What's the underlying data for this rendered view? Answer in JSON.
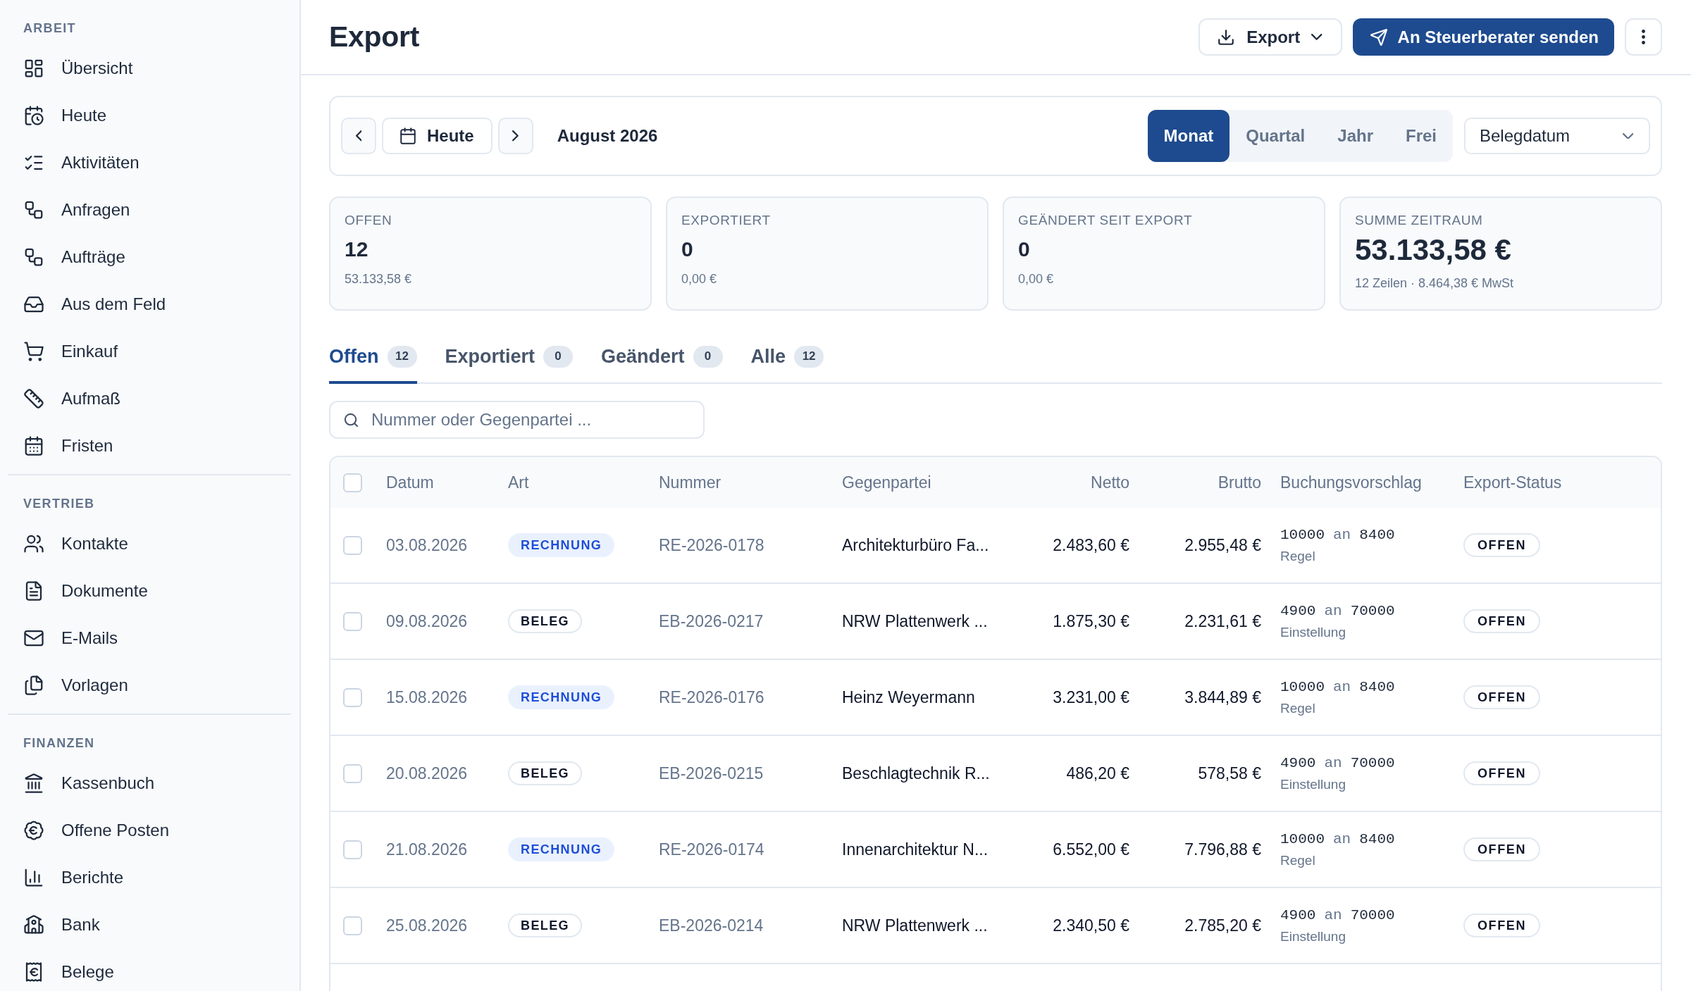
{
  "sidebar": {
    "sections": [
      {
        "title": "ARBEIT",
        "items": [
          {
            "label": "Übersicht",
            "selected": false
          },
          {
            "label": "Heute",
            "selected": false
          },
          {
            "label": "Aktivitäten",
            "selected": false
          },
          {
            "label": "Anfragen",
            "selected": false
          },
          {
            "label": "Aufträge",
            "selected": false
          },
          {
            "label": "Aus dem Feld",
            "selected": false
          },
          {
            "label": "Einkauf",
            "selected": false
          },
          {
            "label": "Aufmaß",
            "selected": false
          },
          {
            "label": "Fristen",
            "selected": false
          }
        ]
      },
      {
        "title": "VERTRIEB",
        "items": [
          {
            "label": "Kontakte",
            "selected": false
          },
          {
            "label": "Dokumente",
            "selected": false
          },
          {
            "label": "E-Mails",
            "selected": false
          },
          {
            "label": "Vorlagen",
            "selected": false
          }
        ]
      },
      {
        "title": "FINANZEN",
        "items": [
          {
            "label": "Kassenbuch",
            "selected": false
          },
          {
            "label": "Offene Posten",
            "selected": false
          },
          {
            "label": "Berichte",
            "selected": false
          },
          {
            "label": "Bank",
            "selected": false
          },
          {
            "label": "Belege",
            "selected": false
          }
        ]
      }
    ]
  },
  "header": {
    "title": "Export",
    "export_button": "Export",
    "send_button": "An Steuerberater senden"
  },
  "period_bar": {
    "today_button": "Heute",
    "period_label": "August 2026",
    "ranges": [
      {
        "label": "Monat",
        "selected": true
      },
      {
        "label": "Quartal",
        "selected": false
      },
      {
        "label": "Jahr",
        "selected": false
      },
      {
        "label": "Frei",
        "selected": false
      }
    ],
    "date_field": {
      "value": "Belegdatum"
    }
  },
  "stats": [
    {
      "kind": "count",
      "label": "OFFEN",
      "value": "12",
      "detail": "53.133,58 €"
    },
    {
      "kind": "count",
      "label": "EXPORTIERT",
      "value": "0",
      "detail": "0,00 €"
    },
    {
      "kind": "count",
      "label": "GEÄNDERT SEIT EXPORT",
      "value": "0",
      "detail": "0,00 €"
    },
    {
      "kind": "total",
      "label": "SUMME ZEITRAUM",
      "value": "53.133,58 €",
      "detail": "12 Zeilen · 8.464,38 € MwSt"
    }
  ],
  "tabs": [
    {
      "label": "Offen",
      "count": "12",
      "selected": true
    },
    {
      "label": "Exportiert",
      "count": "0",
      "selected": false
    },
    {
      "label": "Geändert",
      "count": "0",
      "selected": false
    },
    {
      "label": "Alle",
      "count": "12",
      "selected": false
    }
  ],
  "search": {
    "placeholder": "Nummer oder Gegenpartei ..."
  },
  "table": {
    "select_all_checked": false,
    "columns": [
      "Datum",
      "Art",
      "Nummer",
      "Gegenpartei",
      "Netto",
      "Brutto",
      "Buchungsvorschlag",
      "Export-Status"
    ],
    "rows": [
      {
        "checked": false,
        "date": "03.08.2026",
        "type": {
          "kind": "invoice",
          "label": "RECHNUNG"
        },
        "number": "RE-2026-0178",
        "counterparty": "Architekturbüro Fa...",
        "net": "2.483,60 €",
        "gross": "2.955,48 €",
        "booking": {
          "debit": "10000",
          "connector": "an",
          "credit": "8400",
          "source": "Regel"
        },
        "status": "OFFEN"
      },
      {
        "checked": false,
        "date": "09.08.2026",
        "type": {
          "kind": "receipt",
          "label": "BELEG"
        },
        "number": "EB-2026-0217",
        "counterparty": "NRW Plattenwerk ...",
        "net": "1.875,30 €",
        "gross": "2.231,61 €",
        "booking": {
          "debit": "4900",
          "connector": "an",
          "credit": "70000",
          "source": "Einstellung"
        },
        "status": "OFFEN"
      },
      {
        "checked": false,
        "date": "15.08.2026",
        "type": {
          "kind": "invoice",
          "label": "RECHNUNG"
        },
        "number": "RE-2026-0176",
        "counterparty": "Heinz Weyermann",
        "net": "3.231,00 €",
        "gross": "3.844,89 €",
        "booking": {
          "debit": "10000",
          "connector": "an",
          "credit": "8400",
          "source": "Regel"
        },
        "status": "OFFEN"
      },
      {
        "checked": false,
        "date": "20.08.2026",
        "type": {
          "kind": "receipt",
          "label": "BELEG"
        },
        "number": "EB-2026-0215",
        "counterparty": "Beschlagtechnik R...",
        "net": "486,20 €",
        "gross": "578,58 €",
        "booking": {
          "debit": "4900",
          "connector": "an",
          "credit": "70000",
          "source": "Einstellung"
        },
        "status": "OFFEN"
      },
      {
        "checked": false,
        "date": "21.08.2026",
        "type": {
          "kind": "invoice",
          "label": "RECHNUNG"
        },
        "number": "RE-2026-0174",
        "counterparty": "Innenarchitektur N...",
        "net": "6.552,00 €",
        "gross": "7.796,88 €",
        "booking": {
          "debit": "10000",
          "connector": "an",
          "credit": "8400",
          "source": "Regel"
        },
        "status": "OFFEN"
      },
      {
        "checked": false,
        "date": "25.08.2026",
        "type": {
          "kind": "receipt",
          "label": "BELEG"
        },
        "number": "EB-2026-0214",
        "counterparty": "NRW Plattenwerk ...",
        "net": "2.340,50 €",
        "gross": "2.785,20 €",
        "booking": {
          "debit": "4900",
          "connector": "an",
          "credit": "70000",
          "source": "Einstellung"
        },
        "status": "OFFEN"
      }
    ]
  }
}
